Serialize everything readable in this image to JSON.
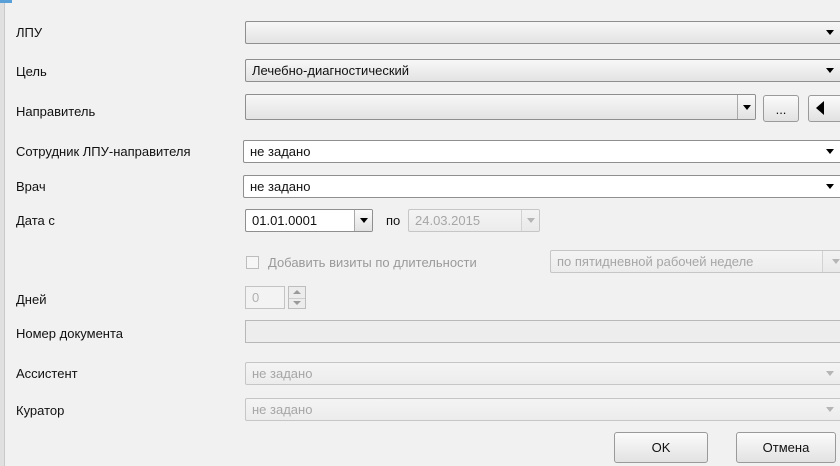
{
  "labels": {
    "lpu": "ЛПУ",
    "goal": "Цель",
    "referrer": "Направитель",
    "referrer_staff": "Сотрудник ЛПУ-направителя",
    "doctor": "Врач",
    "date_from": "Дата с",
    "days": "Дней",
    "doc_number": "Номер документа",
    "assistant": "Ассистент",
    "curator": "Куратор"
  },
  "fields": {
    "lpu": "",
    "goal": "Лечебно-диагностический",
    "referrer": "",
    "referrer_staff": "не задано",
    "doctor": "не задано",
    "date_from": "01.01.0001",
    "date_to_label": "по",
    "date_to": "24.03.2015",
    "add_visits_label": "Добавить визиты по длительности",
    "duration_mode": "по пятидневной рабочей неделе",
    "days_value": "0",
    "doc_number": "",
    "assistant": "не задано",
    "curator": "не задано"
  },
  "buttons": {
    "browse": "...",
    "ok": "OK",
    "cancel": "Отмена"
  }
}
